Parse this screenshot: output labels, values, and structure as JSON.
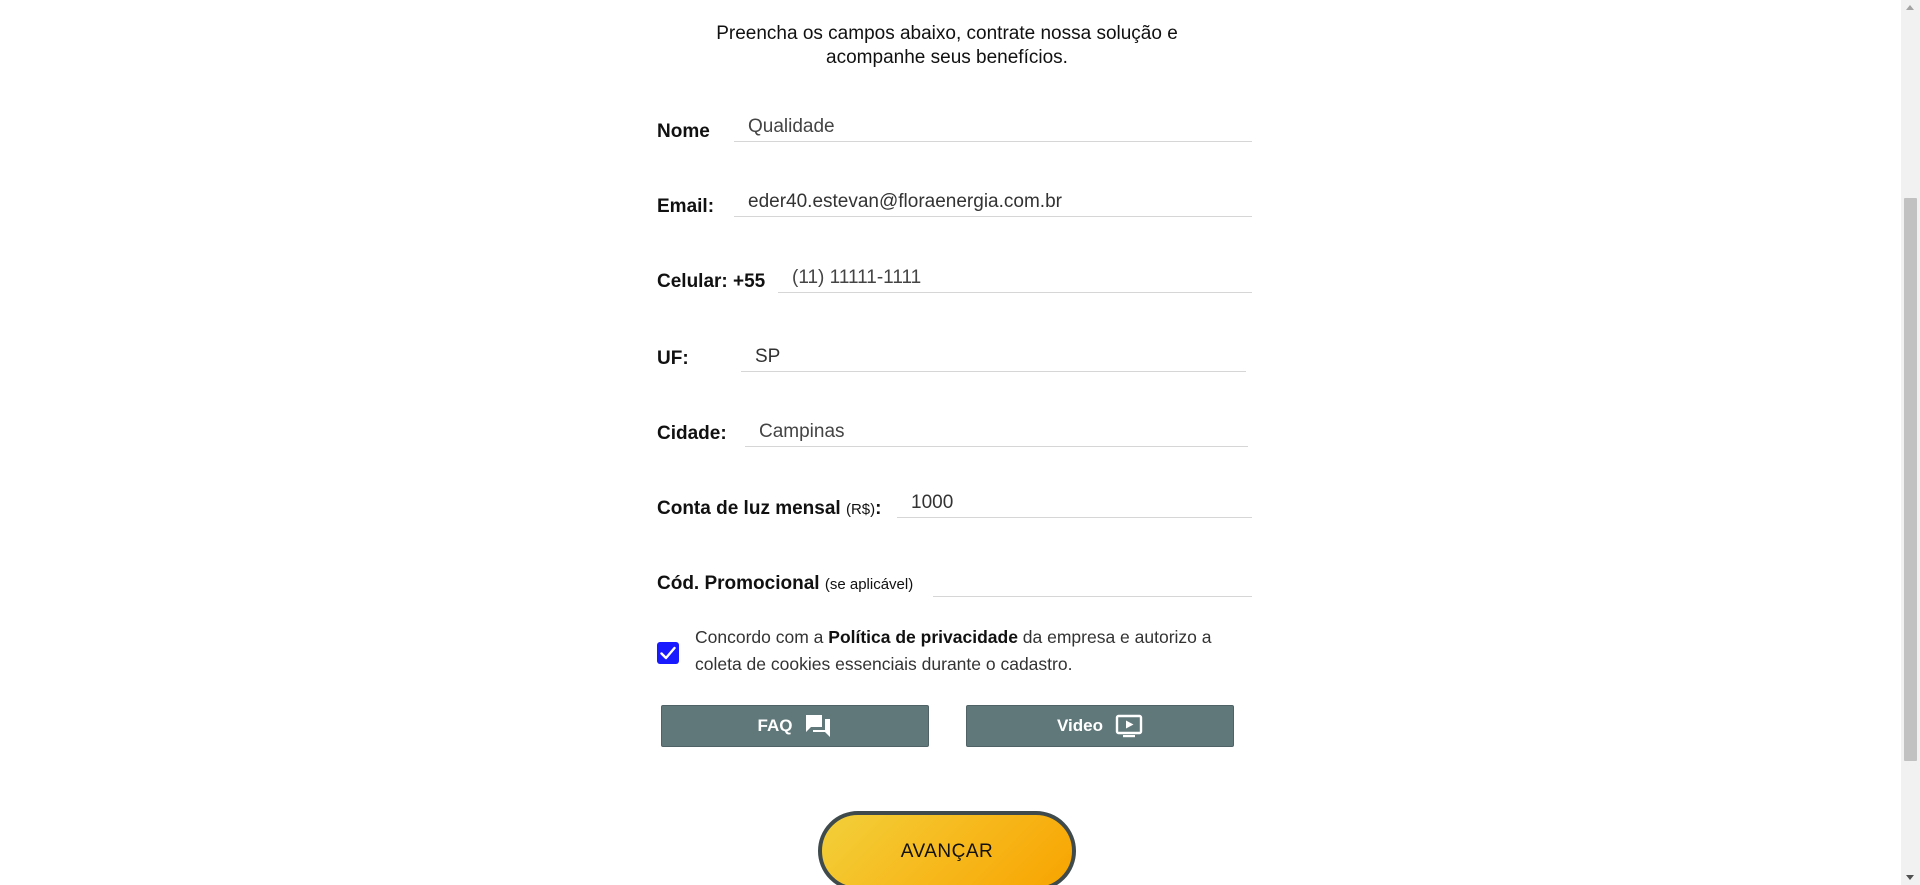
{
  "intro": {
    "line1": "Preencha os campos abaixo, contrate nossa solução e",
    "line2": "acompanhe seus benefícios."
  },
  "form": {
    "nome": {
      "label": "Nome",
      "value": "Qualidade"
    },
    "email": {
      "label": "Email:",
      "value": "eder40.estevan@floraenergia.com.br"
    },
    "celular": {
      "label": "Celular: +55",
      "value": "(11) 11111-1111"
    },
    "uf": {
      "label": "UF:",
      "value": "SP"
    },
    "cidade": {
      "label": "Cidade:",
      "value": "Campinas"
    },
    "conta": {
      "label": "Conta de luz mensal",
      "sub": "(R$)",
      "colon": ":",
      "value": "1000"
    },
    "promo": {
      "label": "Cód. Promocional",
      "sub": "(se aplicável)",
      "value": ""
    }
  },
  "consent": {
    "checked": true,
    "prefix": "Concordo com a ",
    "link": "Política de privacidade",
    "suffix": " da empresa e autorizo a coleta de cookies essenciais durante o cadastro."
  },
  "buttons": {
    "faq": "FAQ",
    "video": "Video",
    "advance": "AVANÇAR"
  },
  "icons": {
    "faq": "chat-bubbles-icon",
    "video": "play-screen-icon",
    "check": "checkmark-icon"
  },
  "colors": {
    "button_bg": "#61787b",
    "checkbox": "#1a1aff",
    "advance_gradient_start": "#f2d03a",
    "advance_gradient_end": "#f7a400"
  }
}
